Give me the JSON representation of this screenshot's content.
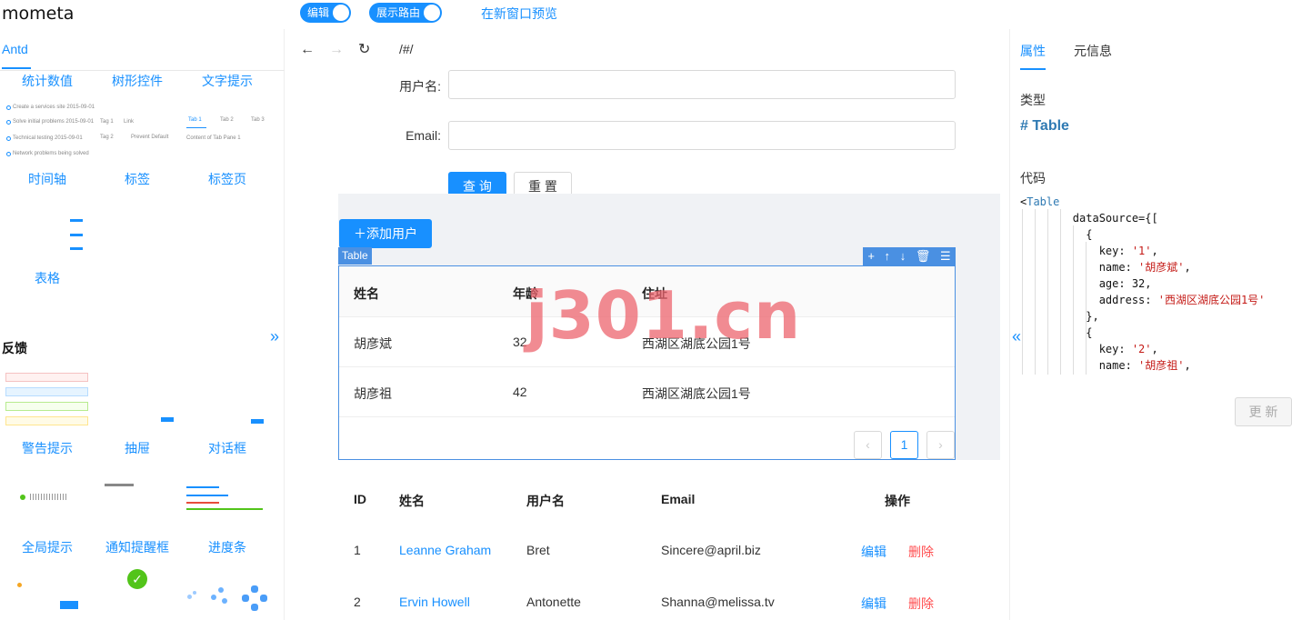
{
  "app": {
    "title": "mometa"
  },
  "toolbar": {
    "edit_label": "编辑",
    "route_label": "展示路由",
    "preview_link": "在新窗口预览"
  },
  "left": {
    "tab": "Antd",
    "row1": [
      "统计数值",
      "树形控件",
      "文字提示"
    ],
    "row2": [
      "时间轴",
      "标签",
      "标签页"
    ],
    "row3": [
      "表格"
    ],
    "section": "反馈",
    "row4": [
      "警告提示",
      "抽屉",
      "对话框"
    ],
    "row5": [
      "全局提示",
      "通知提醒框",
      "进度条"
    ],
    "timeline_items": [
      "Create a services site 2015-09-01",
      "Solve initial problems 2015-09-01",
      "Technical testing 2015-09-01",
      "Network problems being solved"
    ],
    "tag_items": [
      "Tag 1",
      "Link",
      "Tag 2",
      "Prevent Default"
    ],
    "tabs_items": [
      "Tab 1",
      "Tab 2",
      "Tab 3"
    ],
    "tabs_content": "Content of Tab Pane 1"
  },
  "nav": {
    "back": "←",
    "forward": "→",
    "reload": "↻",
    "route": "/#/"
  },
  "form": {
    "username_label": "用户名:",
    "email_label": "Email:",
    "query_button": "查 询",
    "reset_button": "重 置"
  },
  "canvas": {
    "add_user": "＋添加用户",
    "table_tag": "Table",
    "columns": [
      "姓名",
      "年龄",
      "住址"
    ],
    "rows": [
      {
        "name": "胡彦斌",
        "age": "32",
        "address": "西湖区湖底公园1号"
      },
      {
        "name": "胡彦祖",
        "age": "42",
        "address": "西湖区湖底公园1号"
      }
    ],
    "page": "1",
    "watermark": "j301.cn"
  },
  "users": {
    "columns": [
      "ID",
      "姓名",
      "用户名",
      "Email",
      "操作"
    ],
    "rows": [
      {
        "id": "1",
        "name": "Leanne Graham",
        "username": "Bret",
        "email": "Sincere@april.biz"
      },
      {
        "id": "2",
        "name": "Ervin Howell",
        "username": "Antonette",
        "email": "Shanna@melissa.tv"
      }
    ],
    "edit": "编辑",
    "delete": "删除"
  },
  "right": {
    "tab_props": "属性",
    "tab_meta": "元信息",
    "type_label": "类型",
    "type_value": "# Table",
    "code_label": "代码",
    "update_button": "更 新"
  },
  "colors": {
    "accent": "#1890ff",
    "danger": "#ff4d4f",
    "selection": "#4a90e2"
  }
}
